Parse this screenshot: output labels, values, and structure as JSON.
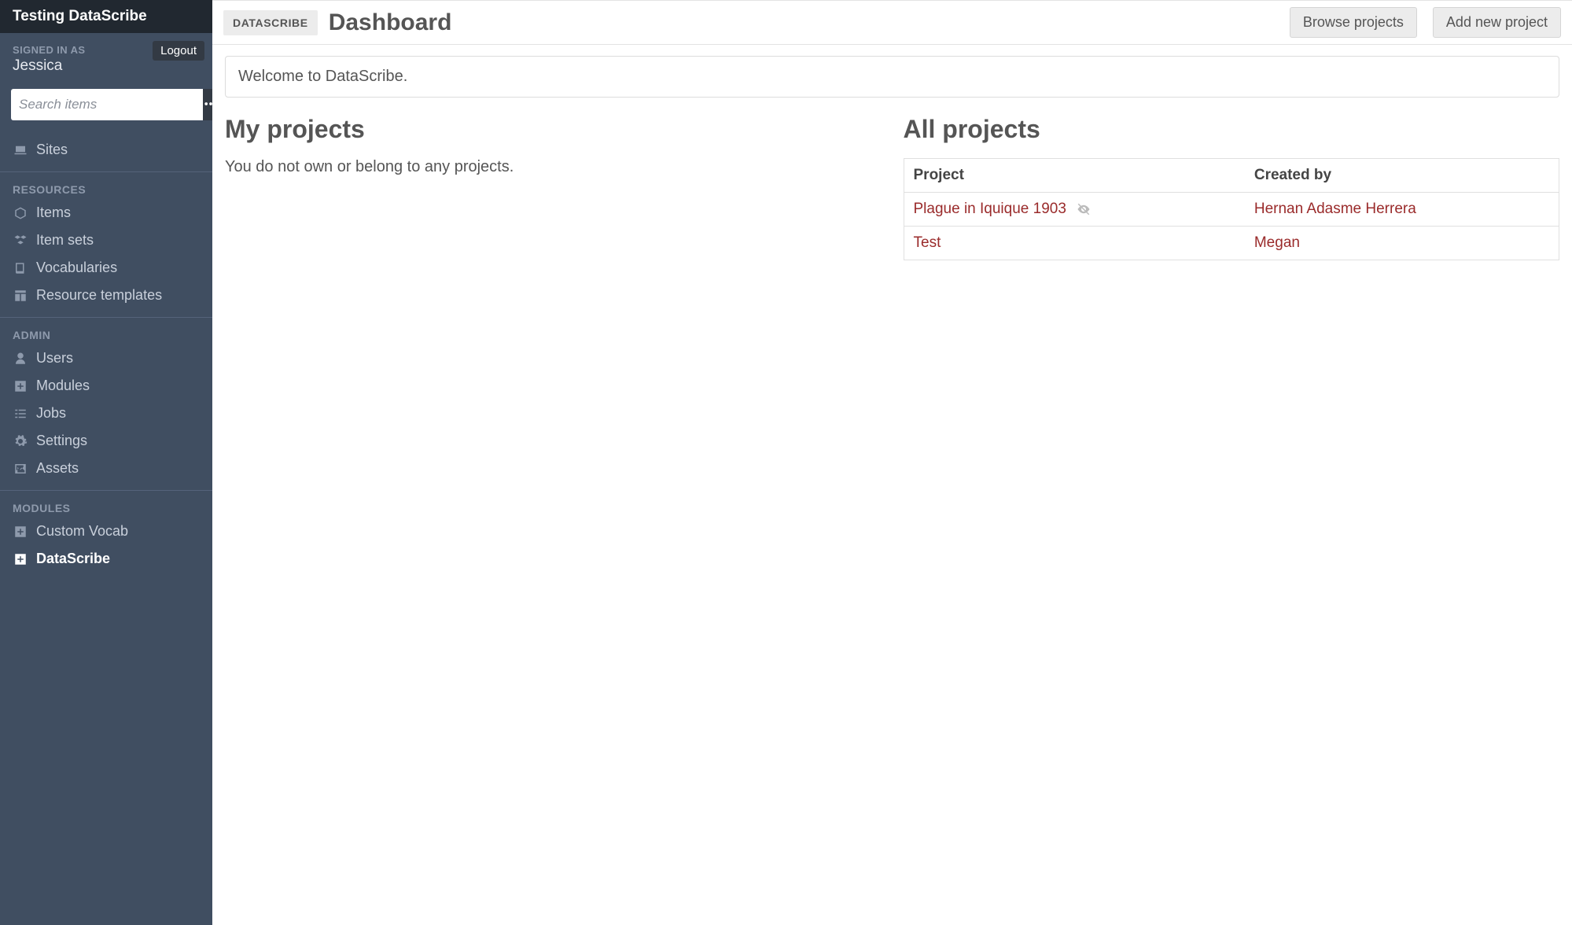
{
  "site_title": "Testing DataScribe",
  "user": {
    "signed_in_label": "Signed in as",
    "name": "Jessica",
    "logout_label": "Logout"
  },
  "search": {
    "placeholder": "Search items"
  },
  "nav": {
    "sites_label": "Sites",
    "resources_heading": "Resources",
    "resources": [
      {
        "label": "Items",
        "icon": "cube-icon"
      },
      {
        "label": "Item sets",
        "icon": "cubes-icon"
      },
      {
        "label": "Vocabularies",
        "icon": "book-icon"
      },
      {
        "label": "Resource templates",
        "icon": "template-icon"
      }
    ],
    "admin_heading": "Admin",
    "admin": [
      {
        "label": "Users",
        "icon": "user-icon"
      },
      {
        "label": "Modules",
        "icon": "plus-square-icon"
      },
      {
        "label": "Jobs",
        "icon": "tasks-icon"
      },
      {
        "label": "Settings",
        "icon": "cogs-icon"
      },
      {
        "label": "Assets",
        "icon": "image-icon"
      }
    ],
    "modules_heading": "Modules",
    "modules": [
      {
        "label": "Custom Vocab",
        "icon": "plus-square-icon",
        "active": false
      },
      {
        "label": "DataScribe",
        "icon": "plus-square-icon",
        "active": true
      }
    ]
  },
  "header": {
    "breadcrumb": "DataScribe",
    "title": "Dashboard",
    "browse_button": "Browse projects",
    "add_button": "Add new project"
  },
  "welcome": "Welcome to DataScribe.",
  "my_projects": {
    "heading": "My projects",
    "empty": "You do not own or belong to any projects."
  },
  "all_projects": {
    "heading": "All projects",
    "columns": {
      "project": "Project",
      "created_by": "Created by"
    },
    "rows": [
      {
        "project": "Plague in Iquique 1903",
        "created_by": "Hernan Adasme Herrera",
        "hidden": true
      },
      {
        "project": "Test",
        "created_by": "Megan",
        "hidden": false
      }
    ]
  }
}
